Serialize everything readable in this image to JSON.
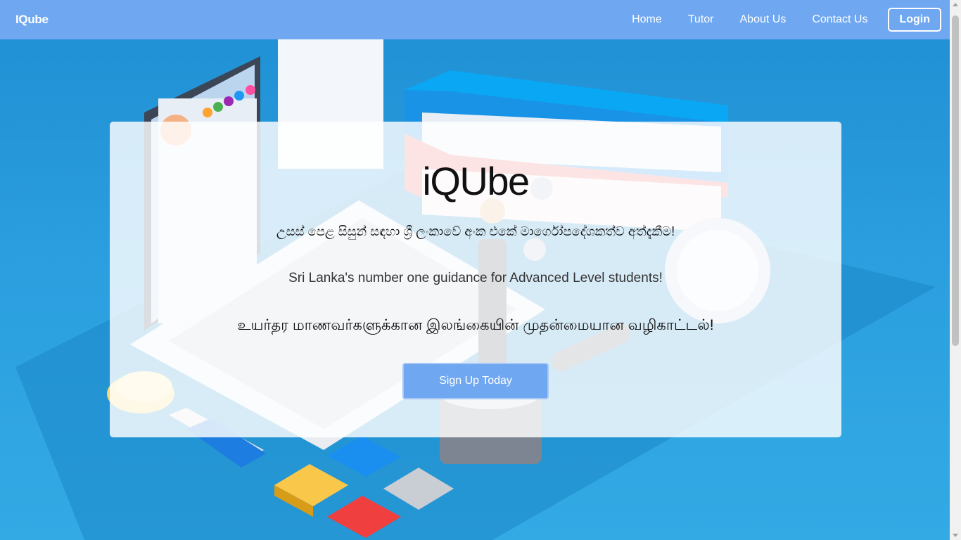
{
  "navbar": {
    "brand": "IQube",
    "links": [
      "Home",
      "Tutor",
      "About Us",
      "Contact Us"
    ],
    "login_label": "Login"
  },
  "hero": {
    "title": "iQUbe",
    "tagline_sinhala": "උසස් පෙළ සිසුන් සඳහා ශ්‍රී ලංකාවේ අංක එකේ මාර්ගෝපදේශකත්ව අත්දැකීම!",
    "tagline_english": "Sri Lanka's number one guidance for Advanced Level students!",
    "tagline_tamil": "உயர்தர மாணவர்களுக்கான இலங்கையின் முதன்மையான வழிகாட்டல்!",
    "signup_label": "Sign Up Today"
  },
  "colors": {
    "navbar_bg": "#6fa7f1",
    "hero_bg": "#2a9ad8",
    "button_bg": "#6fa7f1"
  }
}
